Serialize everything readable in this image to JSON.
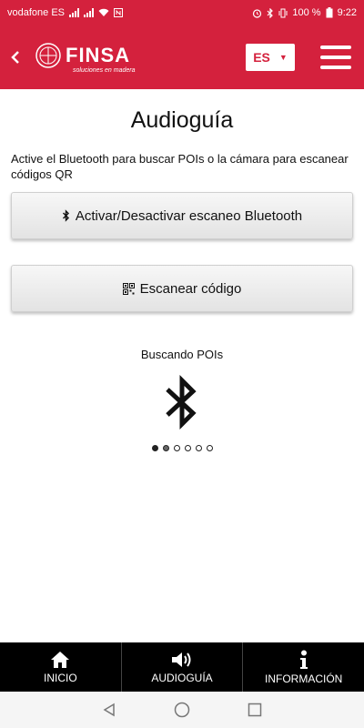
{
  "status": {
    "carrier": "vodafone ES",
    "battery": "100 %",
    "time": "9:22"
  },
  "header": {
    "brand": "FINSA",
    "tagline": "soluciones en madera",
    "language": "ES",
    "accent_color": "#d4213d"
  },
  "main": {
    "title": "Audioguía",
    "description": "Active el Bluetooth para buscar POIs o la cámara para escanear códigos QR",
    "bluetooth_button": "Activar/Desactivar escaneo Bluetooth",
    "scan_button": "Escanear código",
    "searching_label": "Buscando POIs"
  },
  "bottom_nav": {
    "items": [
      {
        "label": "INICIO",
        "icon": "home-icon"
      },
      {
        "label": "AUDIOGUÍA",
        "icon": "speaker-icon"
      },
      {
        "label": "INFORMACIÓN",
        "icon": "info-icon"
      }
    ]
  }
}
